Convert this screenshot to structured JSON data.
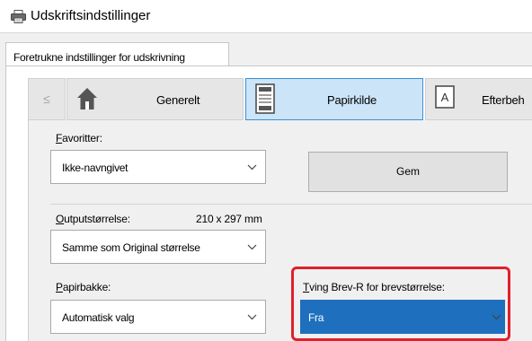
{
  "window": {
    "title": "Udskriftsindstillinger",
    "icon": "printer-icon"
  },
  "tabs": [
    {
      "label": "Foretrukne indstillinger for udskrivning",
      "active": true
    }
  ],
  "nav": {
    "prev_label": "≤",
    "items": [
      {
        "label": "Generelt",
        "icon": "home-icon",
        "selected": false
      },
      {
        "label": "Papirkilde",
        "icon": "paper-tray-icon",
        "selected": true
      },
      {
        "label": "Efterbeh",
        "icon": "finishing-icon",
        "selected": false
      }
    ]
  },
  "favorites": {
    "label_first": "F",
    "label_rest": "avoritter:",
    "value": "Ikke-navngivet",
    "save_first": "G",
    "save_rest": "em"
  },
  "output_size": {
    "label_first": "O",
    "label_rest": "utputstørrelse:",
    "size_text": "210 x 297 mm",
    "value": "Samme som Original størrelse"
  },
  "paper_tray": {
    "label_first": "P",
    "label_rest": "apirbakke:",
    "value": "Automatisk valg"
  },
  "force_letter": {
    "label_first": "T",
    "label_rest": "ving Brev-R for brevstørrelse:",
    "value": "Fra"
  },
  "colors": {
    "accent": "#1f6fbf",
    "selected_tab": "#cce4f7",
    "highlight": "#e0202a"
  }
}
